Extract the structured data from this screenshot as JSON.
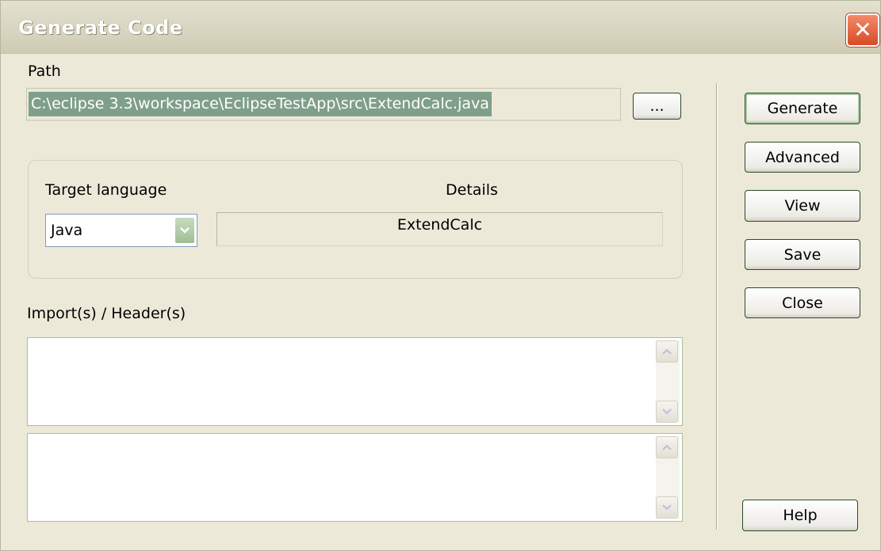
{
  "window": {
    "title": "Generate Code",
    "close_symbol": "✕",
    "close_icon": "close-icon"
  },
  "path": {
    "label": "Path",
    "value": "C:\\eclipse 3.3\\workspace\\EclipseTestApp\\src\\ExtendCalc.java",
    "browse_label": "..."
  },
  "language_group": {
    "target_label": "Target language",
    "selected_language": "Java",
    "details_label": "Details",
    "details_value": "ExtendCalc"
  },
  "imports": {
    "label": "Import(s) / Header(s)",
    "text_1": "",
    "text_2": ""
  },
  "buttons": {
    "generate": "Generate",
    "advanced": "Advanced",
    "view": "View",
    "save": "Save",
    "close": "Close",
    "help": "Help"
  },
  "colors": {
    "dialog_bg": "#ece9d8",
    "selection_highlight": "#7f9f8a",
    "close_button": "#d94a26"
  }
}
